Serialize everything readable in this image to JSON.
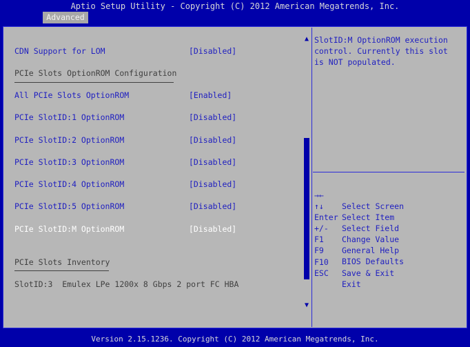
{
  "header": {
    "title": "Aptio Setup Utility - Copyright (C) 2012 American Megatrends, Inc."
  },
  "tabs": [
    {
      "label": "Advanced"
    }
  ],
  "settings": [
    {
      "label": "CDN Support for LOM",
      "value": "[Disabled]"
    },
    {
      "label": "All PCIe Slots OptionROM",
      "value": "[Enabled]"
    },
    {
      "label": "PCIe SlotID:1 OptionROM",
      "value": "[Disabled]"
    },
    {
      "label": "PCIe SlotID:2 OptionROM",
      "value": "[Disabled]"
    },
    {
      "label": "PCIe SlotID:3 OptionROM",
      "value": "[Disabled]"
    },
    {
      "label": "PCIe SlotID:4 OptionROM",
      "value": "[Disabled]"
    },
    {
      "label": "PCIe SlotID:5 OptionROM",
      "value": "[Disabled]"
    },
    {
      "label": "PCIe SlotID:M OptionROM",
      "value": "[Disabled]"
    }
  ],
  "headings": {
    "optionrom_config": "PCIe Slots OptionROM Configuration",
    "inventory": "PCIe Slots Inventory"
  },
  "inventory_item": "SlotID:3  Emulex LPe 1200x 8 Gbps 2 port FC HBA",
  "help": {
    "text": "SlotID:M OptionROM execution\ncontrol. Currently this slot\nis NOT populated."
  },
  "keys": [
    {
      "key": "→←",
      "desc": "Select Screen"
    },
    {
      "key": "↑↓",
      "desc": "Select Item"
    },
    {
      "key": "Enter",
      "desc": "Select Field"
    },
    {
      "key": "+/-",
      "desc": "Change Value"
    },
    {
      "key": "F1",
      "desc": "General Help"
    },
    {
      "key": "F9",
      "desc": "BIOS Defaults"
    },
    {
      "key": "F10",
      "desc": "Save & Exit"
    },
    {
      "key": "ESC",
      "desc": "Exit"
    }
  ],
  "footer": {
    "text": "Version 2.15.1236. Copyright (C) 2012 American Megatrends, Inc."
  },
  "colors": {
    "background": "#0000aa",
    "panel": "#b7b7b7",
    "option_text": "#2020c0",
    "selected_text": "#ffffff",
    "heading_text": "#404040"
  },
  "scrollbar": {
    "position_fraction": 0.37,
    "visible_fraction": 0.55
  }
}
